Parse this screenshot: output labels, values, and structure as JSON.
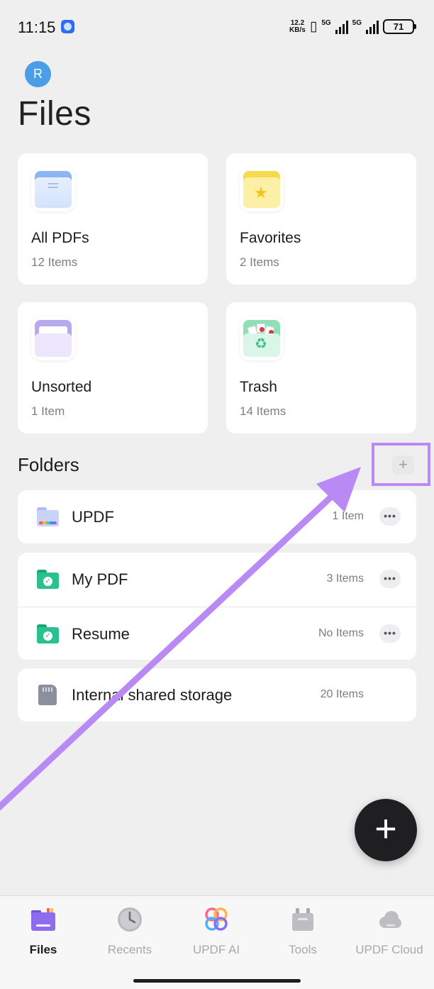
{
  "status_bar": {
    "time": "11:15",
    "net_speed_value": "12.2",
    "net_speed_unit": "KB/s",
    "signal_1_label": "5G",
    "signal_2_label": "5G",
    "battery": "71"
  },
  "header": {
    "avatar_initial": "R",
    "title": "Files"
  },
  "categories": [
    {
      "name": "All PDFs",
      "count": "12 Items",
      "icon": "all-pdfs-icon"
    },
    {
      "name": "Favorites",
      "count": "2 Items",
      "icon": "favorites-star-icon"
    },
    {
      "name": "Unsorted",
      "count": "1 Item",
      "icon": "unsorted-tray-icon"
    },
    {
      "name": "Trash",
      "count": "14 Items",
      "icon": "trash-recycle-icon"
    }
  ],
  "folders_section": {
    "title": "Folders",
    "add_label": "+"
  },
  "folders": [
    {
      "name": "UPDF",
      "count": "1 Item",
      "more": "•••"
    },
    {
      "name": "My PDF",
      "count": "3 Items",
      "more": "•••"
    },
    {
      "name": "Resume",
      "count": "No Items",
      "more": "•••"
    }
  ],
  "storage": {
    "name": "Internal shared storage",
    "count": "20 Items"
  },
  "fab": {
    "label": "+"
  },
  "bottom_nav": [
    {
      "label": "Files",
      "icon": "files-folder-icon",
      "active": true
    },
    {
      "label": "Recents",
      "icon": "clock-icon",
      "active": false
    },
    {
      "label": "UPDF AI",
      "icon": "updf-ai-icon",
      "active": false
    },
    {
      "label": "Tools",
      "icon": "toolbox-icon",
      "active": false
    },
    {
      "label": "UPDF Cloud",
      "icon": "cloud-icon",
      "active": false
    }
  ],
  "colors": {
    "background": "#efeff0",
    "annotation": "#b98af4",
    "avatar": "#4a9ee8",
    "active_nav": "#8e6cf0"
  }
}
